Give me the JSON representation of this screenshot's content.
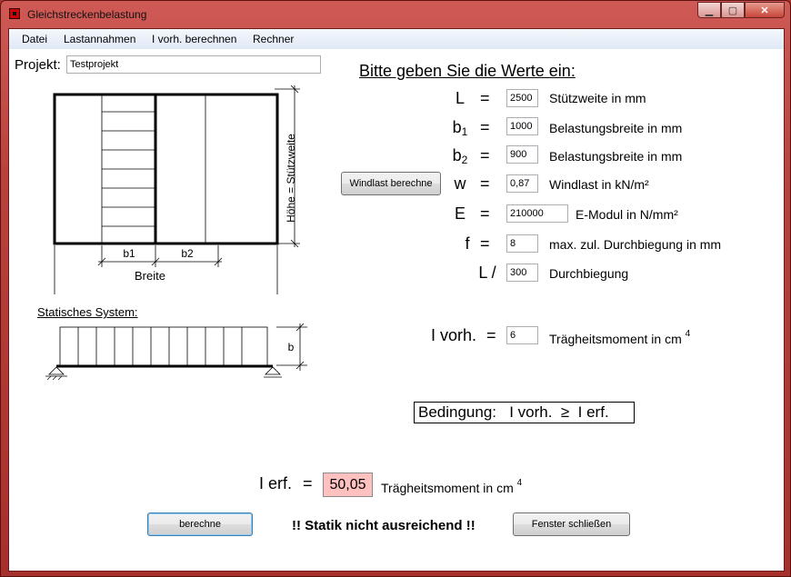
{
  "window": {
    "title": "Gleichstreckenbelastung",
    "min_glyph": "▁",
    "max_glyph": "▢",
    "close_glyph": "✕"
  },
  "menu": [
    "Datei",
    "Lastannahmen",
    "I vorh. berechnen",
    "Rechner"
  ],
  "projekt": {
    "label": "Projekt:",
    "value": "Testprojekt"
  },
  "diagram1": {
    "height_label": "Höhe = Stützweite",
    "b1": "b1",
    "b2": "b2",
    "width_label": "Breite"
  },
  "diagram2": {
    "title": "Statisches System:",
    "b_label": "b"
  },
  "heading": "Bitte geben Sie die Werte ein:",
  "windlast_button": "Windlast berechne",
  "params": [
    {
      "symbol": "L",
      "sub": "",
      "eq": "=",
      "value": "2500",
      "desc": "Stützweite in mm"
    },
    {
      "symbol": "b",
      "sub": "1",
      "eq": "=",
      "value": "1000",
      "desc": "Belastungsbreite in mm"
    },
    {
      "symbol": "b",
      "sub": "2",
      "eq": "=",
      "value": "900",
      "desc": "Belastungsbreite in mm"
    },
    {
      "symbol": "w",
      "sub": "",
      "eq": "=",
      "value": "0,87",
      "desc": "Windlast in kN/m²"
    },
    {
      "symbol": "E",
      "sub": "",
      "eq": "=",
      "value": "210000",
      "desc": "E-Modul in N/mm²"
    },
    {
      "symbol": "f",
      "sub": "",
      "eq": "=",
      "value": "8",
      "desc": "max. zul. Durchbiegung in mm"
    },
    {
      "symbol": "L /",
      "sub": "",
      "eq": "",
      "value": "300",
      "desc": "Durchbiegung"
    }
  ],
  "ivorh": {
    "label": "I vorh.",
    "eq": "=",
    "value": "6",
    "desc": "Trägheitsmoment in cm",
    "sup": "4"
  },
  "bedingung": "Bedingung:   I vorh.  ≥  I erf.",
  "ierf": {
    "label": "I erf.",
    "eq": "=",
    "value": "50,05",
    "desc": "Trägheitsmoment in cm",
    "sup": "4",
    "highlight": "#ffc0c0"
  },
  "berechne_button": "berechne",
  "status_message": "!! Statik nicht ausreichend !!",
  "close_button": "Fenster schließen"
}
